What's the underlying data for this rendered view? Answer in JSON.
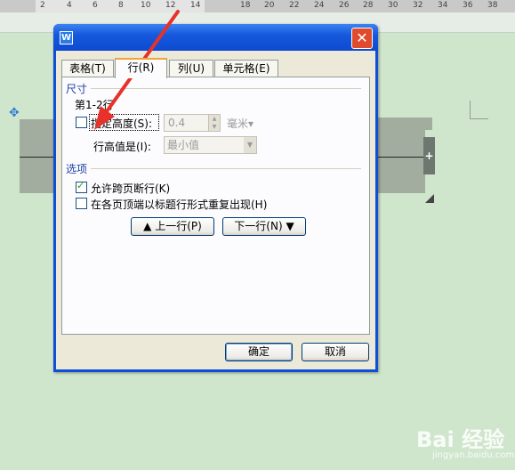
{
  "ruler": {
    "ticks": [
      "2",
      "4",
      "6",
      "8",
      "10",
      "12",
      "14",
      "18",
      "20",
      "22",
      "24",
      "26",
      "28",
      "30",
      "32",
      "34",
      "36",
      "38"
    ]
  },
  "dialog": {
    "app_icon": "W",
    "close_label": "✕",
    "tabs": [
      "表格(T)",
      "行(R)",
      "列(U)",
      "单元格(E)"
    ],
    "size_group": "尺寸",
    "row_range": "第1-2行",
    "specify_height_label": "指定高度(S):",
    "height_value": "0.4",
    "height_unit": "毫米▾",
    "row_height_is_label": "行高值是(I):",
    "row_height_is_value": "最小值",
    "options_group": "选项",
    "allow_break_label": "允许跨页断行(K)",
    "repeat_header_label": "在各页顶端以标题行形式重复出现(H)",
    "prev_row_label": "上一行(P)",
    "next_row_label": "下一行(N)",
    "ok_label": "确定",
    "cancel_label": "取消"
  },
  "state": {
    "specify_height_checked": false,
    "allow_break_checked": true,
    "repeat_header_checked": false,
    "active_tab": "行(R)"
  },
  "watermark": {
    "text": "Bai 经验",
    "sub": "jingyan.baidu.com"
  },
  "colors": {
    "page_bg": "#cfe6cd",
    "titlebar": "#1659dc",
    "arrow": "#e8312a",
    "group_text": "#1b3fa3"
  }
}
